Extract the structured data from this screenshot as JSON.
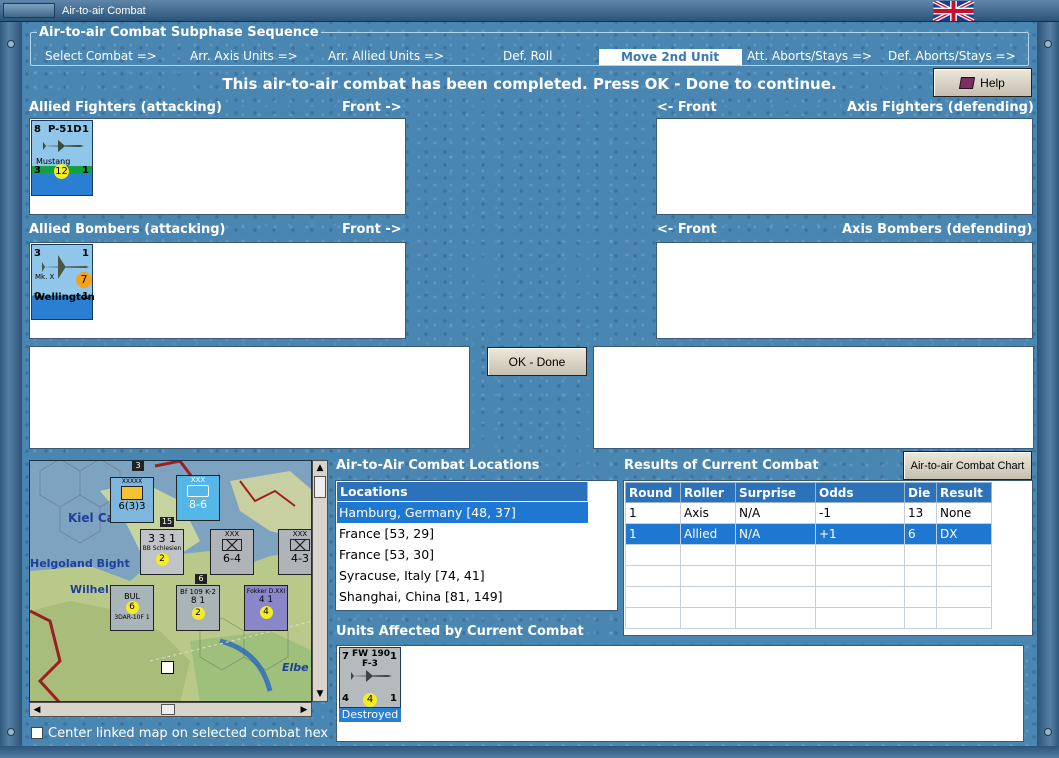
{
  "window": {
    "title": "Air-to-air Combat"
  },
  "subphase": {
    "title": "Air-to-air Combat Subphase Sequence",
    "steps": [
      "Select Combat =>",
      "Arr. Axis Units =>",
      "Arr. Allied Units =>",
      "Def. Roll",
      "Move 2nd Unit",
      "Att. Aborts/Stays =>",
      "Def. Aborts/Stays =>"
    ],
    "current": "Move 2nd Unit"
  },
  "status_message": "This air-to-air combat has been completed.  Press OK - Done to continue.",
  "help_label": "Help",
  "panels": {
    "allied_fighters": {
      "label": "Allied Fighters (attacking)",
      "front": "Front ->"
    },
    "axis_fighters": {
      "label": "Axis Fighters (defending)",
      "front": "<- Front"
    },
    "allied_bombers": {
      "label": "Allied Bombers (attacking)",
      "front": "Front ->"
    },
    "axis_bombers": {
      "label": "Axis Bombers (defending)",
      "front": "<- Front"
    }
  },
  "units": {
    "p51d": {
      "name": "P-51D",
      "type": "Mustang",
      "left": "8",
      "right": "1",
      "bottom_left": "3",
      "bottom_right": "1",
      "strength": "12"
    },
    "wellington": {
      "name": "Wellington",
      "type": "Mk. X",
      "left": "3",
      "right": "1",
      "bottom_left": "0",
      "bottom_right": "1",
      "strength": "7"
    },
    "fw190": {
      "name": "FW 190",
      "type": "F-3",
      "left": "7",
      "right": "1",
      "bottom_left": "4",
      "bottom_right": "1",
      "strength": "4",
      "status": "Destroyed"
    }
  },
  "ok_button": "OK - Done",
  "map": {
    "labels": [
      "Kiel Canal",
      "Helgoland Bight",
      "Wilhel",
      "Elbe"
    ],
    "counters": [
      {
        "top": "XXXXX",
        "main": "6(3)3",
        "flag": "GER"
      },
      {
        "top": "XXX",
        "main": "8-6"
      },
      {
        "top": "XXX",
        "main": "6-4"
      },
      {
        "top": "XXX",
        "main": "4-3"
      },
      {
        "top": "BB Schlesien",
        "main": "3 3 1",
        "strength": "2"
      },
      {
        "top": "BUL",
        "main": "3DAR-10F 1",
        "strength": "6"
      },
      {
        "top": "Bf 109 K-2",
        "main": "8 1",
        "strength": "2"
      },
      {
        "top": "Fokker D.XXI",
        "main": "4 1",
        "strength": "4"
      }
    ],
    "stack_numbers": [
      "3",
      "15",
      "6"
    ]
  },
  "center_map_label": "Center linked map on selected combat hex",
  "locations": {
    "title": "Air-to-Air Combat Locations",
    "header": "Locations",
    "items": [
      "Hamburg, Germany [48, 37]",
      "France [53, 29]",
      "France [53, 30]",
      "Syracuse, Italy [74, 41]",
      "Shanghai, China [81, 149]"
    ],
    "selected": "Hamburg, Germany [48, 37]"
  },
  "results": {
    "title": "Results of Current Combat",
    "chart_button": "Air-to-air Combat Chart",
    "headers": [
      "Round",
      "Roller",
      "Surprise",
      "Odds",
      "Die",
      "Result"
    ],
    "rows": [
      [
        "1",
        "Axis",
        "N/A",
        "-1",
        "13",
        "None"
      ],
      [
        "1",
        "Allied",
        "N/A",
        "+1",
        "6",
        "DX"
      ]
    ]
  },
  "units_affected": {
    "title": "Units Affected by Current Combat"
  }
}
